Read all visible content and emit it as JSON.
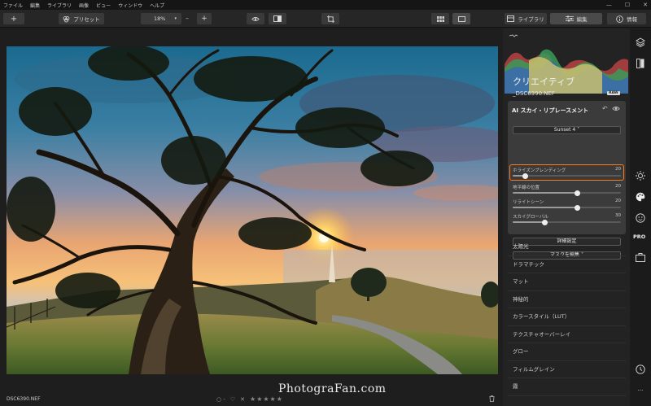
{
  "menu": [
    "ファイル",
    "編集",
    "ライブラリ",
    "画像",
    "ビュー",
    "ウィンドウ",
    "ヘルプ"
  ],
  "window_controls": [
    "—",
    "☐",
    "✕"
  ],
  "toolbar": {
    "add": "+",
    "presets": "プリセット",
    "zoom": "18%",
    "zoom_out": "–",
    "zoom_in": "+",
    "library": "ライブラリ",
    "edit": "編集",
    "info": "情報"
  },
  "photo": {
    "watermark": "PhotograFan.com"
  },
  "bottom": {
    "filename": "DSC6390.NEF",
    "flag": "○ -",
    "heart": "♡",
    "reject": "✕",
    "stars": "★★★★★",
    "trash": "🗑"
  },
  "panel": {
    "title": "クリエイティブ",
    "filename": "_DSC6390.NEF",
    "raw_badge": "RAW",
    "ai_card": {
      "title": "AI スカイ・リプレースメント",
      "preset": "Sunset 4 ˅",
      "sliders": [
        {
          "label": "ホライズンブレンディング",
          "value": "20",
          "level": 0.12
        },
        {
          "label": "地平線の位置",
          "value": "20",
          "level": 0.6
        },
        {
          "label": "リライトシーン",
          "value": "20",
          "level": 0.6
        },
        {
          "label": "スカイグローバル",
          "value": "30",
          "level": 0.3
        }
      ],
      "advanced": "詳細設定",
      "mask": "マスクを編集 ˅"
    },
    "filters": [
      "太陽光",
      "ドラマチック",
      "マット",
      "神秘的",
      "カラースタイル（LUT）",
      "テクスチャオーバーレイ",
      "グロー",
      "フィルムグレイン",
      "霧"
    ]
  },
  "strip": {
    "pro": "PRO",
    "more": "···"
  },
  "colors": {
    "accent_highlight": "#ff7a1a",
    "panel_bg": "#232323",
    "card_bg": "#3b3b3b"
  }
}
